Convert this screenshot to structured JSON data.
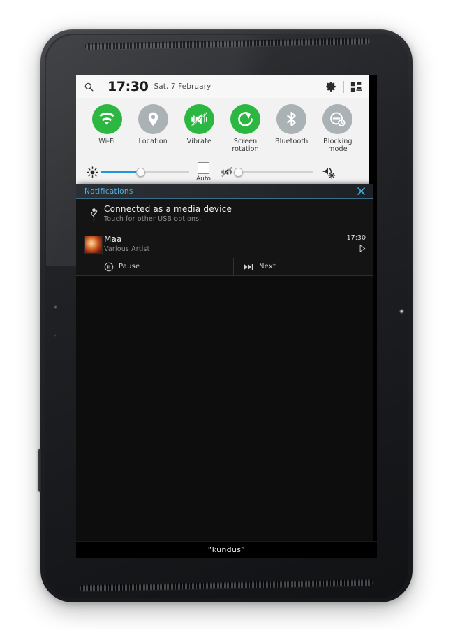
{
  "statusbar": {
    "search_icon": "search-icon",
    "clock": "17:30",
    "date": "Sat, 7 February",
    "settings_icon": "gear-icon",
    "quick_settings_icon": "quick-settings-grid-icon"
  },
  "quick_settings": {
    "toggles": [
      {
        "id": "wifi",
        "label": "Wi-Fi",
        "state": "on",
        "icon": "wifi-icon"
      },
      {
        "id": "location",
        "label": "Location",
        "state": "off",
        "icon": "location-pin-icon"
      },
      {
        "id": "vibrate",
        "label": "Vibrate",
        "state": "on",
        "icon": "vibrate-mute-icon"
      },
      {
        "id": "screen-rotation",
        "label": "Screen rotation",
        "state": "on",
        "icon": "rotate-icon"
      },
      {
        "id": "bluetooth",
        "label": "Bluetooth",
        "state": "off",
        "icon": "bluetooth-icon"
      },
      {
        "id": "blocking-mode",
        "label": "Blocking mode",
        "state": "off",
        "icon": "blocking-mode-icon"
      }
    ],
    "brightness": {
      "icon": "brightness-icon",
      "value_percent": 45,
      "auto_label": "Auto",
      "auto_checked": false
    },
    "volume": {
      "icon": "sound-mute-vibrate-icon",
      "value_percent": 3,
      "settings_icon": "speaker-settings-icon"
    },
    "colors": {
      "toggle_on": "#2cb742",
      "toggle_off": "#aab2b5",
      "slider_fill": "#2196d9",
      "panel_bg": "#f2f2f2"
    }
  },
  "notifications": {
    "header": {
      "title": "Notifications",
      "close_icon": "close-x-icon",
      "accent_color": "#4fb3e0"
    },
    "items": [
      {
        "id": "usb",
        "icon": "usb-icon",
        "title": "Connected as a media device",
        "subtitle": "Touch for other USB options."
      },
      {
        "id": "music",
        "icon": "album-art",
        "title": "Maa",
        "subtitle": "Various Artist",
        "time": "17:30",
        "status_icon": "play-triangle-icon"
      }
    ],
    "media_controls": [
      {
        "id": "pause",
        "label": "Pause",
        "icon": "pause-circle-icon"
      },
      {
        "id": "next",
        "label": "Next",
        "icon": "skip-next-icon"
      }
    ]
  },
  "navbar": {
    "watermark": "“kundus”"
  }
}
